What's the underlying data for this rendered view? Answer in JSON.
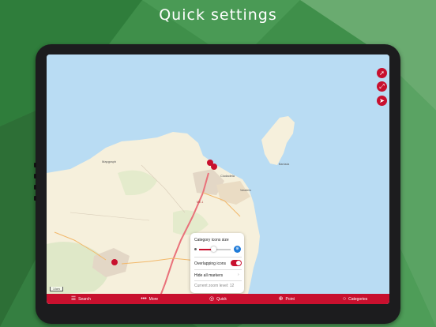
{
  "headline": "Quick settings",
  "map": {
    "labels": {
      "town_west": "Mapgraph",
      "town_center": "Ciudadela",
      "town_harbor": "Varadero",
      "island": "Barriada",
      "road": "ME-1"
    },
    "scale_text": "1 km"
  },
  "map_buttons": {
    "compass_icon": "➚",
    "expand_icon": "⤢",
    "locate_icon": "➤"
  },
  "panel": {
    "title": "Category icons size",
    "slider_value_fraction": 0.45,
    "slider_max_icon": "⊕",
    "overlapping_label": "Overlapping icons",
    "overlapping_on": true,
    "hide_markers_label": "Hide all markers",
    "hide_chevron": "›",
    "zoom_label": "Current zoom level: 12"
  },
  "tabbar": {
    "tabs": [
      {
        "label": "Search",
        "icon": "☰"
      },
      {
        "label": "More",
        "icon": "•••"
      },
      {
        "label": "Quick",
        "icon": "◎"
      },
      {
        "label": "Point",
        "icon": "⊕"
      },
      {
        "label": "Categories",
        "icon": "○"
      }
    ]
  },
  "colors": {
    "accent": "#c8102e",
    "sea": "#b9dcf3",
    "land": "#f6f0dc",
    "background_green": "#3f8f4a"
  }
}
